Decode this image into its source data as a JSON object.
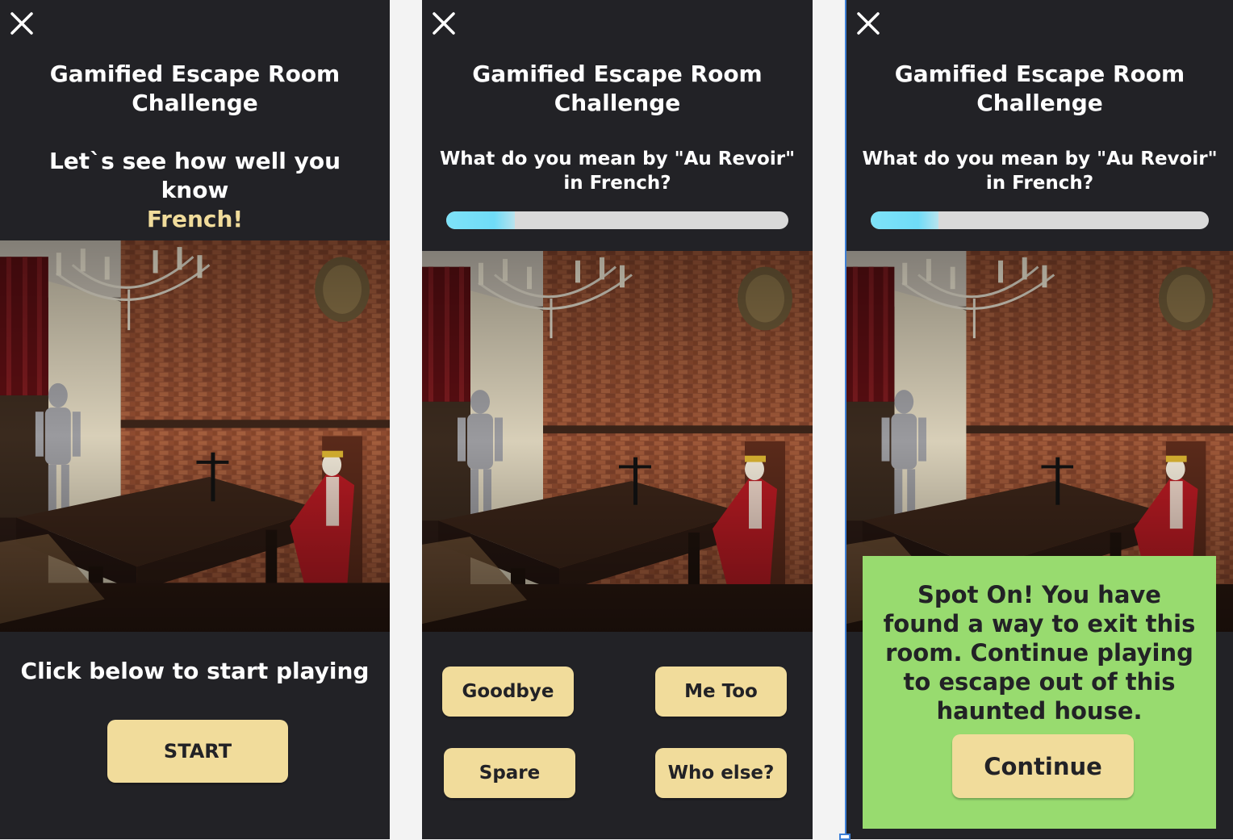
{
  "screens": [
    {
      "title": "Gamified Escape Room Challenge",
      "intro_text": "Let`s see how well you know",
      "intro_highlight": "French!",
      "prompt": "Click below to start playing",
      "start_label": "START",
      "close_icon": "close-icon"
    },
    {
      "title": "Gamified Escape Room Challenge",
      "question": "What do you mean by \"Au Revoir\" in French?",
      "progress": 0.2,
      "options": [
        "Goodbye",
        "Me Too",
        "Spare",
        "Who else?"
      ],
      "close_icon": "close-icon"
    },
    {
      "title": "Gamified Escape Room Challenge",
      "question": "What do you mean by \"Au Revoir\" in French?",
      "progress": 0.2,
      "success_message": "Spot On! You have found a way to exit this room. Continue playing to escape out of this haunted house.",
      "continue_label": "Continue",
      "close_icon": "close-icon"
    }
  ],
  "colors": {
    "background": "#222226",
    "accent": "#f1dc9b",
    "progress": "#7ee2f8",
    "success": "#98db6f"
  }
}
